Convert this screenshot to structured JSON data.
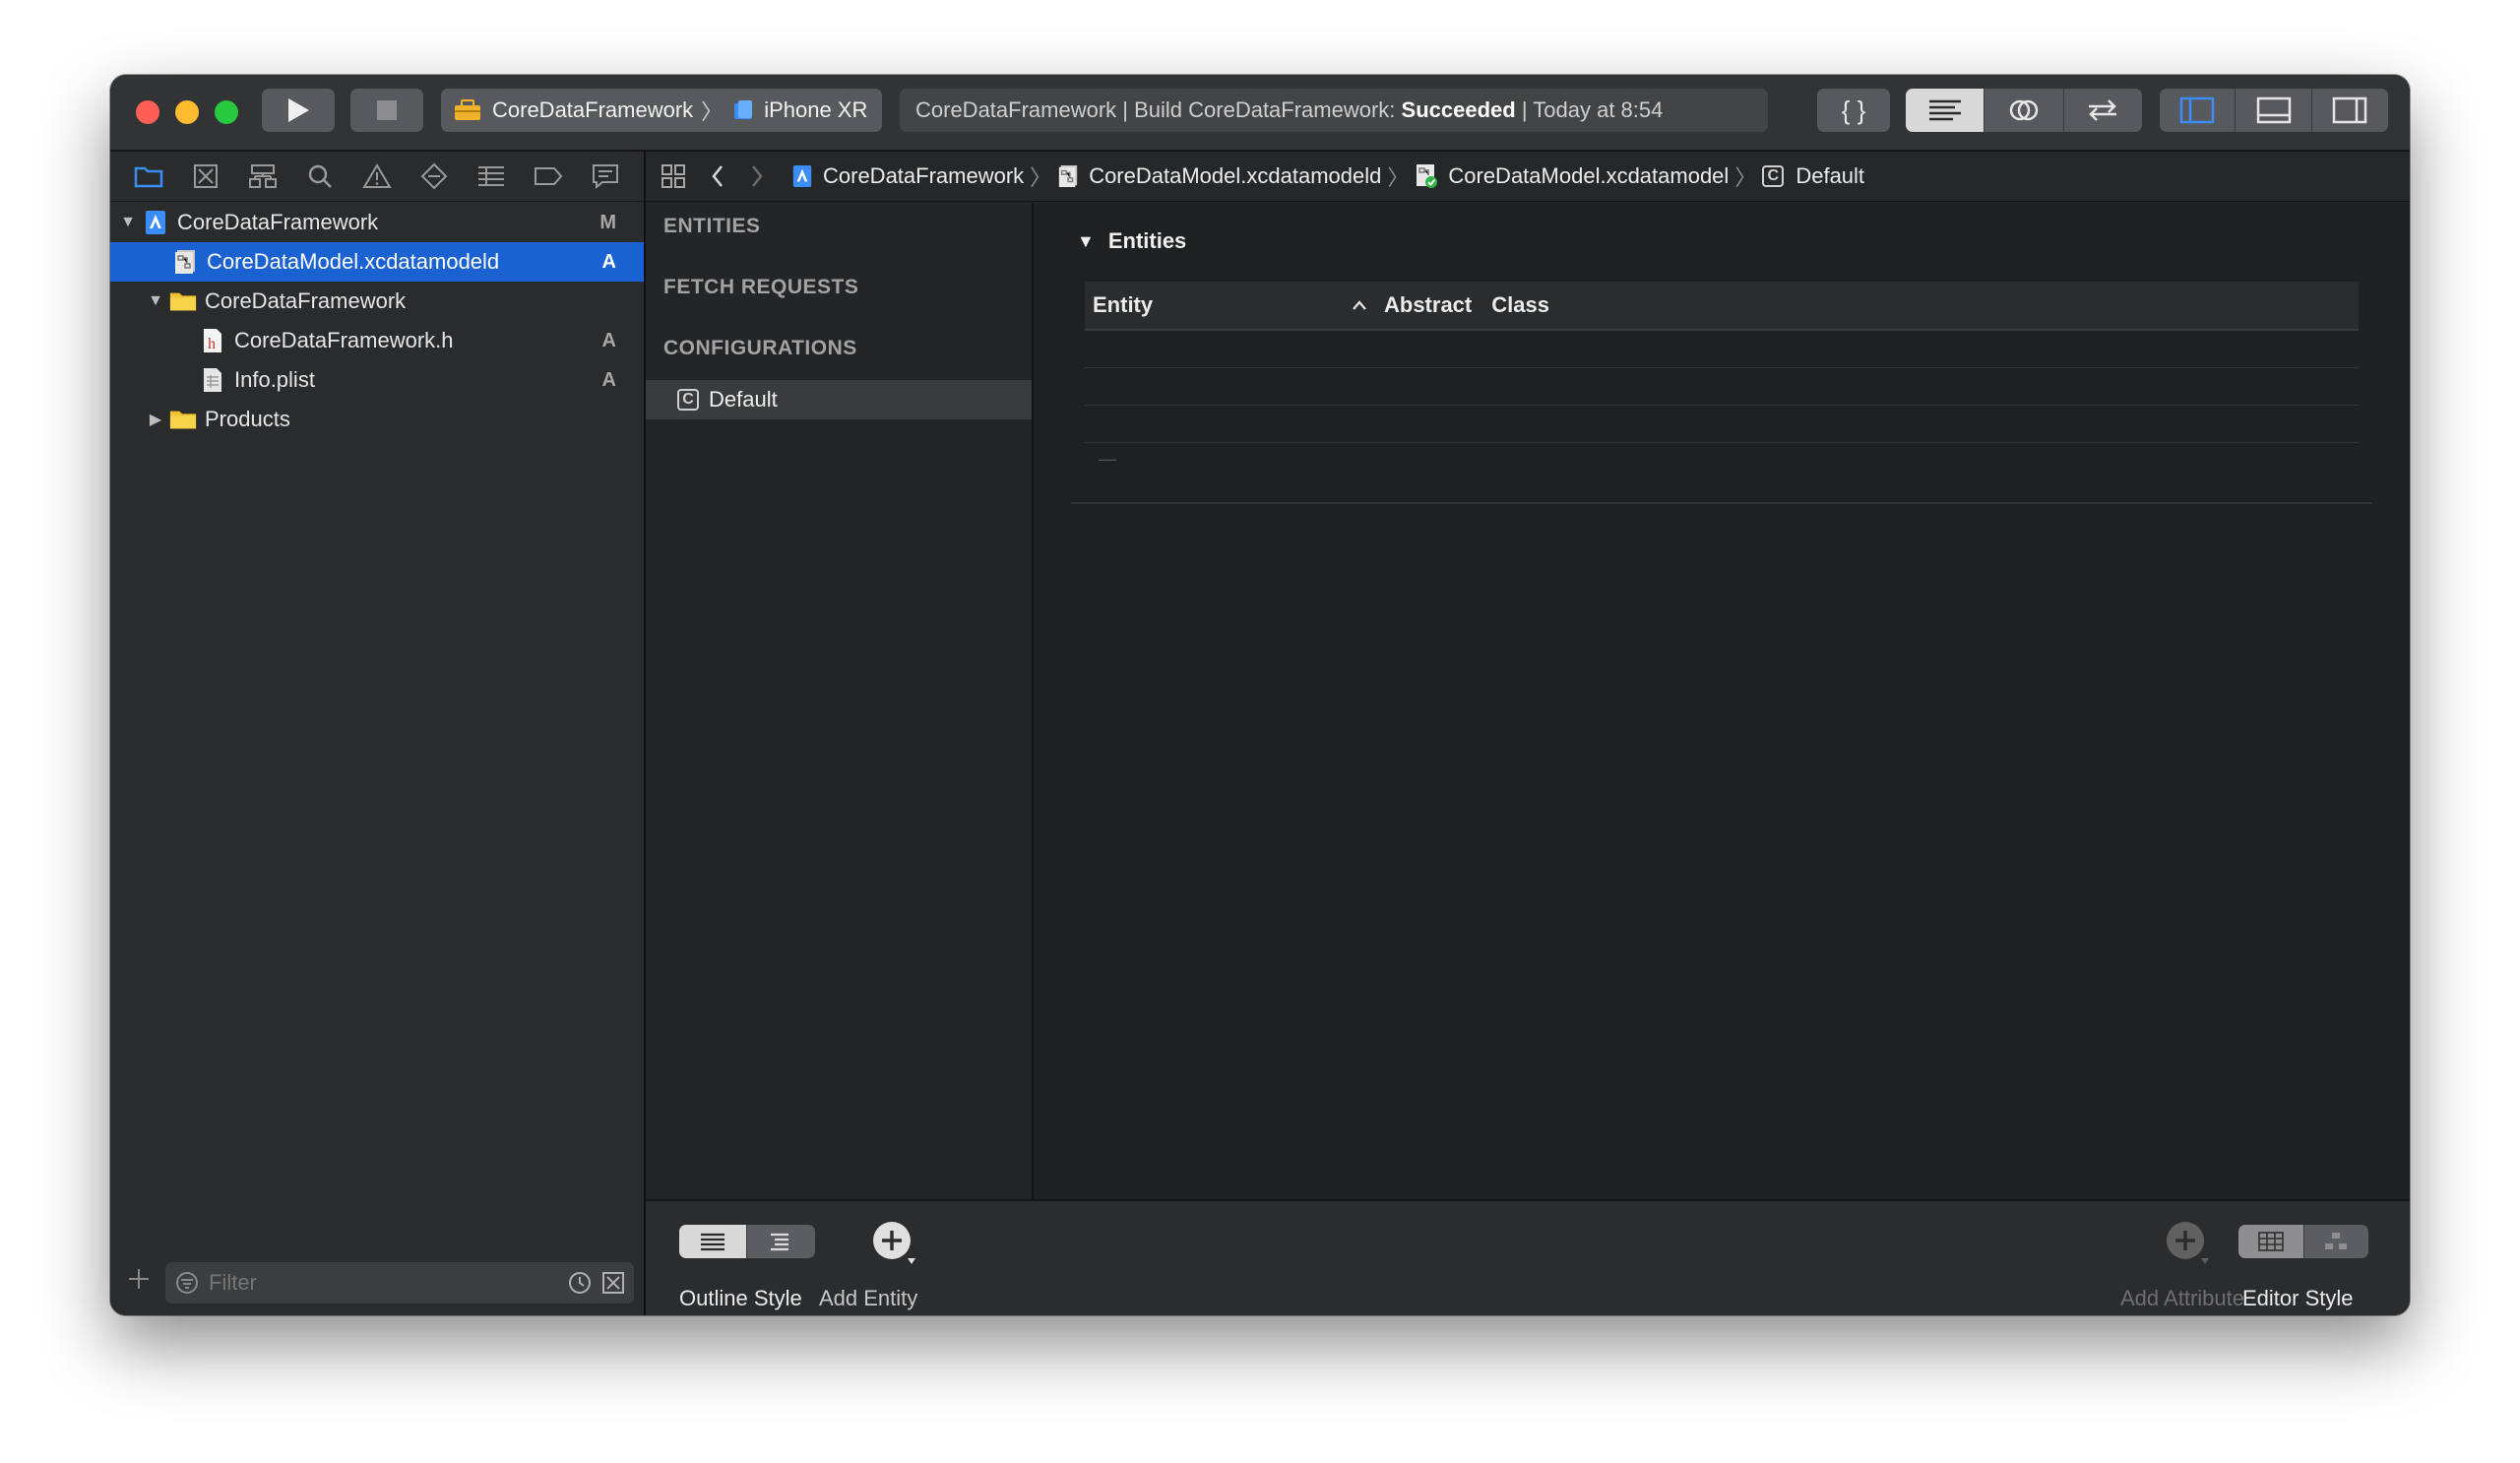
{
  "toolbar": {
    "scheme_target": "CoreDataFramework",
    "scheme_device": "iPhone XR",
    "status_prefix": "CoreDataFramework | Build CoreDataFramework:",
    "status_result": "Succeeded",
    "status_suffix": "| Today at 8:54",
    "code_snippet_label": "{ }"
  },
  "navigator": {
    "tree": [
      {
        "label": "CoreDataFramework",
        "badge": "M",
        "icon": "project-icon"
      },
      {
        "label": "CoreDataModel.xcdatamodeld",
        "badge": "A",
        "icon": "datamodel-icon"
      },
      {
        "label": "CoreDataFramework",
        "badge": "",
        "icon": "folder-icon"
      },
      {
        "label": "CoreDataFramework.h",
        "badge": "A",
        "icon": "header-file-icon"
      },
      {
        "label": "Info.plist",
        "badge": "A",
        "icon": "plist-file-icon"
      },
      {
        "label": "Products",
        "badge": "",
        "icon": "folder-icon"
      }
    ],
    "filter_placeholder": "Filter"
  },
  "jumpbar": {
    "crumbs": [
      "CoreDataFramework",
      "CoreDataModel.xcdatamodeld",
      "CoreDataModel.xcdatamodel",
      "Default"
    ]
  },
  "outline": {
    "entities": "ENTITIES",
    "fetch_requests": "FETCH REQUESTS",
    "configurations": "CONFIGURATIONS",
    "config_item": "Default",
    "config_item_icon_letter": "C"
  },
  "editor": {
    "section_title": "Entities",
    "columns": [
      "Entity",
      "Abstract",
      "Class"
    ],
    "placeholder_dash": "—"
  },
  "bottom": {
    "outline_style": "Outline Style",
    "add_entity": "Add Entity",
    "add_attribute": "Add Attribute",
    "editor_style": "Editor Style"
  },
  "colors": {
    "selection": "#1a62d1",
    "accent": "#3b8cf5",
    "close": "#ff5f57",
    "minimize": "#febc2e",
    "zoom": "#28c840"
  }
}
